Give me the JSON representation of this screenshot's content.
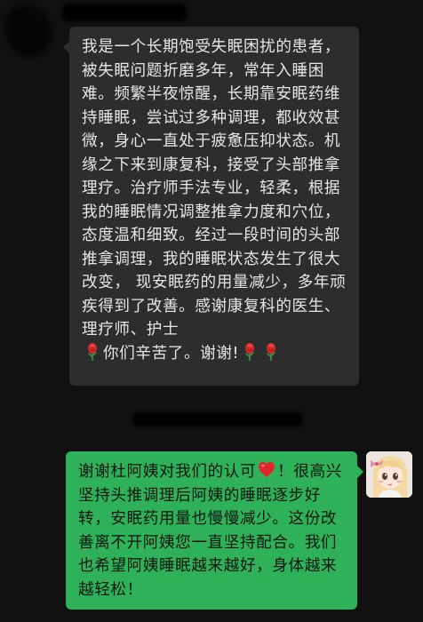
{
  "conversation": {
    "received_message": {
      "text": "我是一个长期饱受失眠困扰的患者，被失眠问题折磨多年，常年入睡困难。频繁半夜惊醒，长期靠安眠药维持睡眠，尝试过多种调理，都收效甚微，身心一直处于疲惫压抑状态。机缘之下来到康复科，接受了头部推拿理疗。治疗师手法专业，轻柔，根据我的睡眠情况调整推拿力度和穴位，态度温和细致。经过一段时间的头部推拿调理，我的睡眠状态发生了很大改变，  现安眠药的用量减少，多年顽疾得到了改善。感谢康复科的医生、理疗师、护士",
      "closing_text": "你们辛苦了。谢谢!",
      "emoji": "rose-emoji"
    },
    "sent_message": {
      "text_before_emoji": "谢谢杜阿姨对我们的认可",
      "emoji": "heart-emoji",
      "text_after_emoji": "！很高兴坚持头推调理后阿姨的睡眠逐步好转，安眠药用量也慢慢减少。这份改善离不开阿姨您一直坚持配合。我们也希望阿姨睡眠越来越好，身体越来越轻松！"
    }
  },
  "colors": {
    "background": "#111111",
    "received_bubble": "#2d2d2d",
    "sent_bubble": "#2fb15a",
    "received_text": "#e6e6e6",
    "sent_text": "#0d150f"
  },
  "icons": {
    "rose": "rose-emoji",
    "heart": "heart-emoji",
    "avatar": "anime-girl-avatar"
  }
}
